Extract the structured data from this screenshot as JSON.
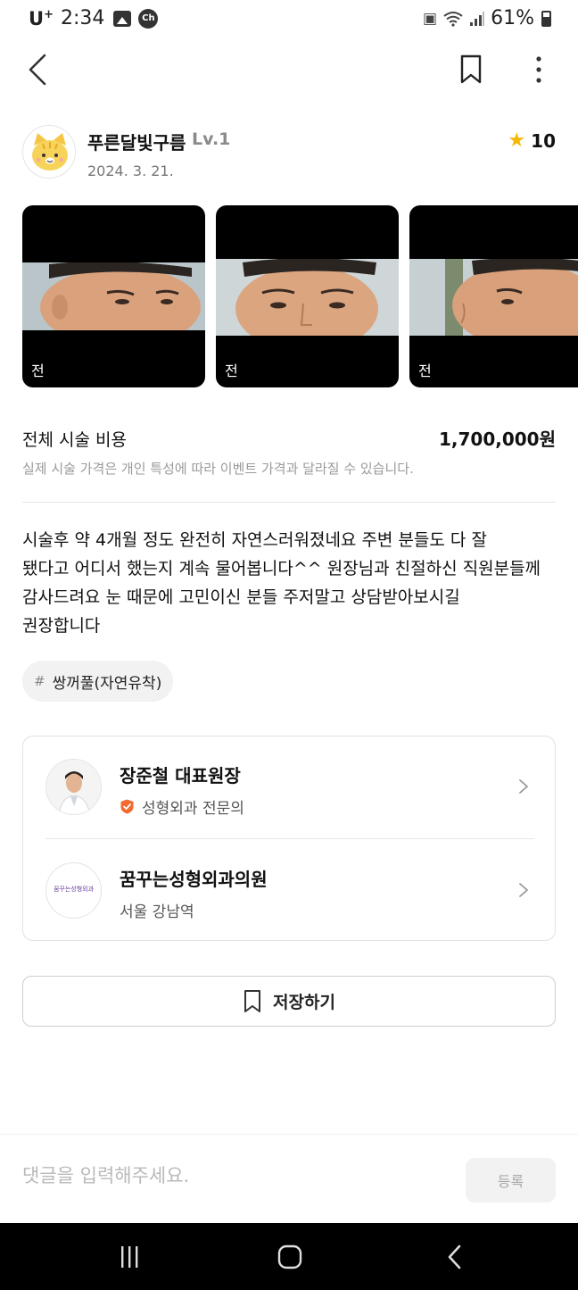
{
  "status_bar": {
    "carrier": "U",
    "carrier_sup": "+",
    "time": "2:34",
    "ch_badge": "Ch",
    "battery": "61%"
  },
  "app_bar": {
    "back_icon": "chevron-left-icon",
    "bookmark_icon": "bookmark-icon",
    "more_icon": "more-vertical-icon"
  },
  "review": {
    "nickname": "푸른달빛구름",
    "level": "Lv.1",
    "date": "2024. 3. 21.",
    "rating": "10",
    "photos": [
      {
        "caption": "전"
      },
      {
        "caption": "전"
      },
      {
        "caption": "전"
      }
    ],
    "cost_label": "전체 시술 비용",
    "cost_value": "1,700,000원",
    "cost_note": "실제 시술 가격은 개인 특성에 따라 이벤트 가격과 달라질 수 있습니다.",
    "body_lines": [
      "시술후 약 4개월 정도 완전히 자연스러워졌네요 주변 분들도 다 잘",
      "됐다고 어디서 했는지 계속 물어봅니다^^ 원장님과 친절하신 직원분들께",
      "감사드려요 눈 때문에 고민이신 분들 주저말고 상담받아보시길",
      "권장합니다"
    ],
    "tag_hash": "#",
    "tag": "쌍꺼풀(자연유착)"
  },
  "doctor": {
    "name": "장준철 대표원장",
    "specialty": "성형외과 전문의"
  },
  "hospital": {
    "name": "꿈꾸는성형외과의원",
    "location": "서울 강남역",
    "logo_text": "꿈꾸는성형외과"
  },
  "save_button": {
    "label": "저장하기"
  },
  "comment": {
    "placeholder": "댓글을 입력해주세요.",
    "submit_label": "등록"
  },
  "colors": {
    "star": "#f5b800",
    "verified": "#f26a2e",
    "text_primary": "#111111",
    "text_muted": "#9a9a9a"
  }
}
